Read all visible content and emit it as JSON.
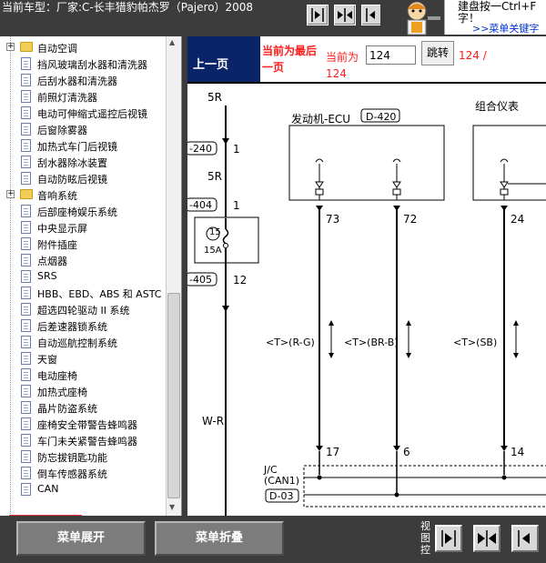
{
  "header": {
    "car_title": "当前车型：厂家:C-长丰猎豹帕杰罗（Pajero）2008",
    "tip_text_line1": "建盘按一Ctrl+F",
    "tip_text_line2": "字！",
    "tip_link": ">>菜单关键字"
  },
  "sidebar": {
    "items": [
      {
        "label": "自动空调",
        "type": "group",
        "toggle": "+"
      },
      {
        "label": "挡风玻璃刮水器和清洗器",
        "type": "doc"
      },
      {
        "label": "后刮水器和清洗器",
        "type": "doc"
      },
      {
        "label": "前照灯清洗器",
        "type": "doc"
      },
      {
        "label": "电动可伸缩式遥控后视镜",
        "type": "doc"
      },
      {
        "label": "后窗除雾器",
        "type": "doc"
      },
      {
        "label": "加热式车门后视镜",
        "type": "doc"
      },
      {
        "label": "刮水器除冰装置",
        "type": "doc"
      },
      {
        "label": "自动防眩后视镜",
        "type": "doc"
      },
      {
        "label": "音响系统",
        "type": "group",
        "toggle": "+"
      },
      {
        "label": "后部座椅娱乐系统",
        "type": "doc"
      },
      {
        "label": "中央显示屏",
        "type": "doc"
      },
      {
        "label": "附件插座",
        "type": "doc"
      },
      {
        "label": "点烟器",
        "type": "doc"
      },
      {
        "label": "SRS",
        "type": "doc"
      },
      {
        "label": "HBB、EBD、ABS 和 ASTC",
        "type": "doc"
      },
      {
        "label": "超选四轮驱动 II 系统",
        "type": "doc"
      },
      {
        "label": "后差速器锁系统",
        "type": "doc"
      },
      {
        "label": "自动巡航控制系统",
        "type": "doc"
      },
      {
        "label": "天窗",
        "type": "doc"
      },
      {
        "label": "电动座椅",
        "type": "doc"
      },
      {
        "label": "加热式座椅",
        "type": "doc"
      },
      {
        "label": "晶片防盗系统",
        "type": "doc"
      },
      {
        "label": "座椅安全带警告蜂鸣器",
        "type": "doc"
      },
      {
        "label": "车门未关紧警告蜂鸣器",
        "type": "doc"
      },
      {
        "label": "防忘拔钥匙功能",
        "type": "doc"
      },
      {
        "label": "倒车传感器系统",
        "type": "doc"
      },
      {
        "label": "CAN",
        "type": "doc",
        "selected": true
      }
    ]
  },
  "nav": {
    "prev_label": "上一页",
    "last_page_note": "当前为最后一页",
    "current_label": "当前为",
    "page_input_value": "124",
    "jump_label": "跳转",
    "page_count": "124 /",
    "current_page_repeat": "124"
  },
  "diagram": {
    "label_5r_top": "5R",
    "conn_240": "-240",
    "pin_1a": "1",
    "label_5r_mid": "5R",
    "conn_404": "-404",
    "pin_1b": "1",
    "fuse_no": "15",
    "fuse_amp": "15A",
    "conn_405": "-405",
    "pin_12": "12",
    "wire_wr": "W-R",
    "ecu_title": "发动机-ECU",
    "ecu_conn": "D-420",
    "combo_title": "组合仪表",
    "pin_73": "73",
    "pin_72": "72",
    "pin_24": "24",
    "wire_rg": "<T>(R-G)",
    "wire_brb": "<T>(BR-B)",
    "wire_sb": "<T>(SB)",
    "pin_17": "17",
    "pin_6": "6",
    "pin_14": "14",
    "jc_label": "J/C",
    "can1_label": "(CAN1)",
    "jc_conn": "D-03"
  },
  "bottom": {
    "expand_label": "菜单展开",
    "collapse_label": "菜单折叠",
    "view_control": "视图控"
  },
  "colors": {
    "accent_red": "#ff1a1a",
    "nav_blue": "#0a246a",
    "chrome_dark": "#3c3c3c",
    "highlight_box": "#e53333"
  }
}
